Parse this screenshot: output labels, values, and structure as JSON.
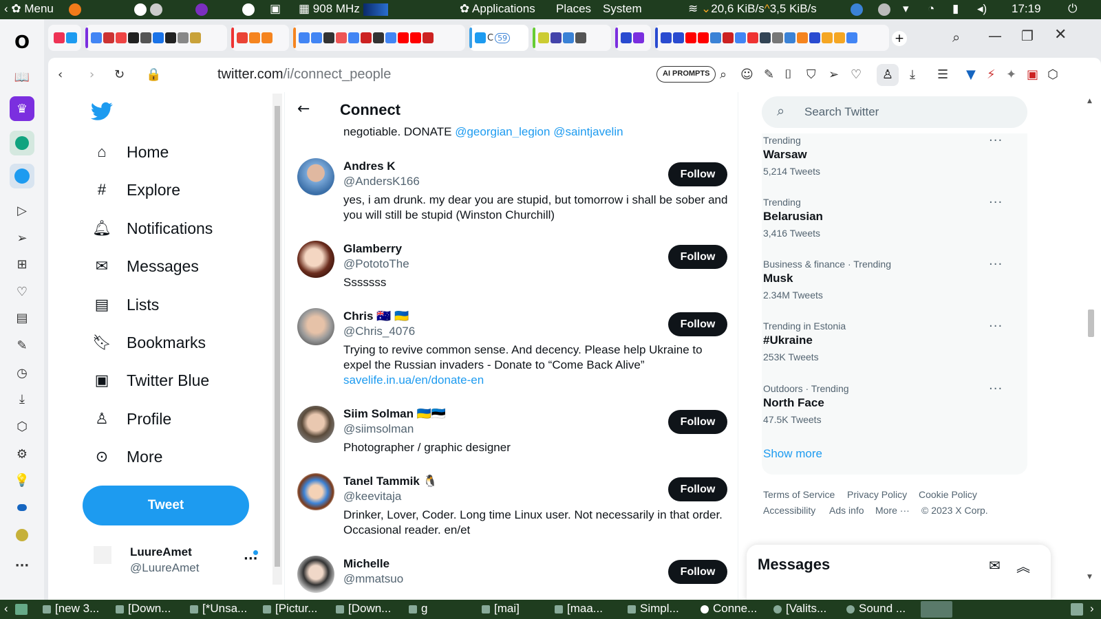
{
  "system_panel": {
    "menu_label": "Menu",
    "cpu_freq": "908 MHz",
    "applications": "Applications",
    "places": "Places",
    "system": "System",
    "net_down": "20,6 KiB/s",
    "net_up": "3,5 KiB/s",
    "clock": "17:19"
  },
  "browser": {
    "url_host": "twitter.com",
    "url_path": "/i/connect_people",
    "ai_prompts_label": "AI PROMPTS",
    "tab_badge": "59"
  },
  "twitter_nav": {
    "items": [
      {
        "label": "Home",
        "icon": "home-icon"
      },
      {
        "label": "Explore",
        "icon": "hashtag-icon"
      },
      {
        "label": "Notifications",
        "icon": "bell-icon"
      },
      {
        "label": "Messages",
        "icon": "envelope-icon"
      },
      {
        "label": "Lists",
        "icon": "list-icon"
      },
      {
        "label": "Bookmarks",
        "icon": "bookmark-icon"
      },
      {
        "label": "Twitter Blue",
        "icon": "twitter-blue-icon"
      },
      {
        "label": "Profile",
        "icon": "person-icon"
      },
      {
        "label": "More",
        "icon": "more-circle-icon"
      }
    ],
    "tweet_button": "Tweet",
    "account_name": "LuureAmet",
    "account_handle": "@LuureAmet"
  },
  "connect": {
    "title": "Connect",
    "partial_bio_text": "negotiable. DONATE ",
    "partial_bio_links": "@georgian_legion @saintjavelin",
    "follow_label": "Follow",
    "users": [
      {
        "name": "Andres K",
        "flags": "",
        "handle": "@AndersK166",
        "bio": "yes, i am drunk. my dear you are stupid, but tomorrow i shall be sober and you will still be stupid (Winston Churchill)",
        "link": ""
      },
      {
        "name": "Glamberry",
        "flags": "",
        "handle": "@PototoThe",
        "bio": "Sssssss",
        "link": ""
      },
      {
        "name": "Chris",
        "flags": "🇦🇺 🇺🇦",
        "handle": "@Chris_4076",
        "bio": "Trying to revive common sense. And decency. Please help Ukraine to expel the Russian invaders - Donate to “Come Back Alive”",
        "link": "savelife.in.ua/en/donate-en"
      },
      {
        "name": "Siim Solman",
        "flags": "🇺🇦🇪🇪",
        "handle": "@siimsolman",
        "bio": "Photographer / graphic designer",
        "link": ""
      },
      {
        "name": "Tanel Tammik",
        "flags": "🐧",
        "handle": "@keevitaja",
        "bio": "Drinker, Lover, Coder. Long time Linux user. Not necessarily in that order. Occasional reader. en/et",
        "link": ""
      },
      {
        "name": "Michelle",
        "flags": "",
        "handle": "@mmatsuo",
        "bio": "",
        "link": ""
      }
    ]
  },
  "right_column": {
    "search_placeholder": "Search Twitter",
    "trends": [
      {
        "context": "Trending",
        "topic": "Warsaw",
        "count": "5,214 Tweets"
      },
      {
        "context": "Trending",
        "topic": "Belarusian",
        "count": "3,416 Tweets"
      },
      {
        "context": "Business & finance · Trending",
        "topic": "Musk",
        "count": "2.34M Tweets"
      },
      {
        "context": "Trending in Estonia",
        "topic": "#Ukraine",
        "count": "253K Tweets"
      },
      {
        "context": "Outdoors · Trending",
        "topic": "North Face",
        "count": "47.5K Tweets"
      }
    ],
    "show_more": "Show more",
    "footer": {
      "terms": "Terms of Service",
      "privacy": "Privacy Policy",
      "cookie": "Cookie Policy",
      "accessibility": "Accessibility",
      "ads": "Ads info",
      "more": "More ···",
      "copyright": "© 2023 X Corp."
    },
    "messages_title": "Messages"
  },
  "taskbar": {
    "items": [
      "[new 3...",
      "[Down...",
      "[*Unsa...",
      "[Pictur...",
      "[Down...",
      "g",
      "[mai]",
      "[maa...",
      "Simpl...",
      "Conne...",
      "[Valits...",
      "Sound ..."
    ]
  },
  "colors": {
    "twitter_blue": "#1d9bf0",
    "follow_button": "#0f1419",
    "panel_green": "#1f3d1f"
  }
}
